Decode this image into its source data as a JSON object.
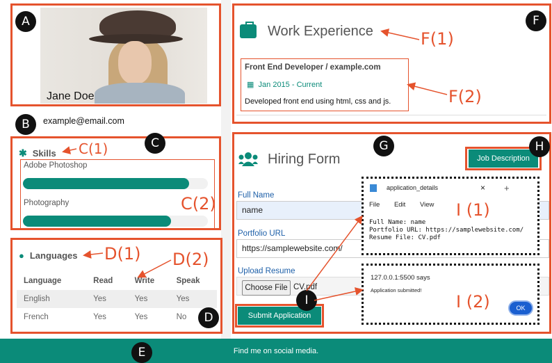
{
  "profile": {
    "name": "Jane Doe",
    "email": "example@email.com"
  },
  "skills": {
    "title": "Skills",
    "items": [
      {
        "label": "Adobe Photoshop",
        "level": 0.9
      },
      {
        "label": "Photography",
        "level": 0.8
      }
    ]
  },
  "languages": {
    "title": "Languages",
    "headers": [
      "Language",
      "Read",
      "Write",
      "Speak"
    ],
    "rows": [
      [
        "English",
        "Yes",
        "Yes",
        "Yes"
      ],
      [
        "French",
        "Yes",
        "Yes",
        "No"
      ]
    ]
  },
  "work": {
    "title": "Work Experience",
    "job_title": "Front End Developer / example.com",
    "job_date": "Jan 2015 - Current",
    "job_desc": "Developed front end using html, css and js."
  },
  "hiring": {
    "title": "Hiring Form",
    "job_desc_button": "Job Description",
    "full_name_label": "Full Name",
    "full_name_value": "name",
    "portfolio_label": "Portfolio URL",
    "portfolio_value": "https://samplewebsite.com/",
    "resume_label": "Upload Resume",
    "choose_file": "Choose File",
    "file_name": "CV.pdf",
    "submit": "Submit Application"
  },
  "dialog1": {
    "tab_title": "application_details",
    "close": "×",
    "new_tab": "+",
    "menu": [
      "File",
      "Edit",
      "View"
    ],
    "body_line1": "Full Name: name",
    "body_line2": "Portfolio URL: https://samplewebsite.com/",
    "body_line3": "Resume File: CV.pdf"
  },
  "dialog2": {
    "origin": "127.0.0.1:5500 says",
    "message": "Application submitted!",
    "ok": "OK"
  },
  "footer": {
    "text": "Find me on social media."
  },
  "annotations": {
    "A": "A",
    "B": "B",
    "C": "C",
    "D": "D",
    "E": "E",
    "F": "F",
    "G": "G",
    "H": "H",
    "I": "I",
    "C1": "C(1)",
    "C2": "C(2)",
    "D1": "D(1)",
    "D2": "D(2)",
    "F1": "F(1)",
    "F2": "F(2)",
    "I1": "I (1)",
    "I2": "I (2)"
  },
  "colors": {
    "accent": "#0b8b79",
    "annotation": "#e5532d"
  }
}
